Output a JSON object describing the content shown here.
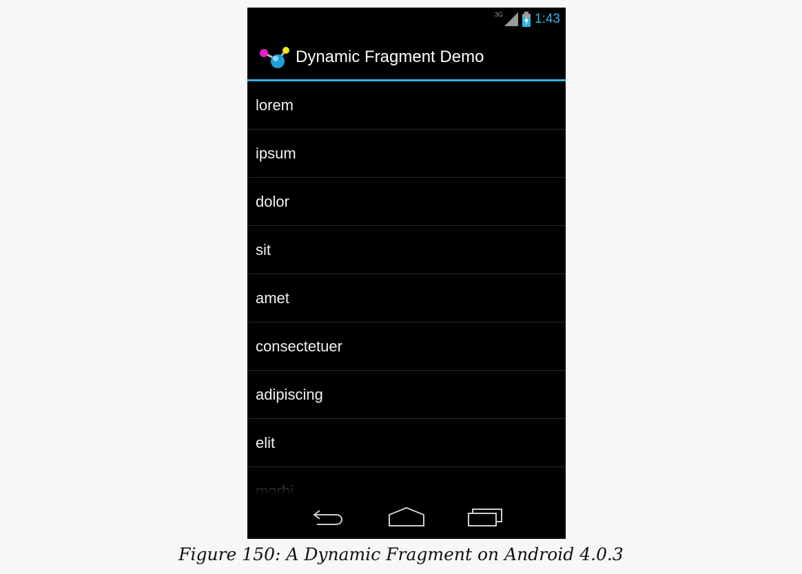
{
  "status_bar": {
    "network": "3G",
    "time": "1:43",
    "icons": [
      "signal-icon",
      "battery-charging-icon"
    ]
  },
  "action_bar": {
    "title": "Dynamic Fragment Demo",
    "icon": "app-icon"
  },
  "list": {
    "items": [
      "lorem",
      "ipsum",
      "dolor",
      "sit",
      "amet",
      "consectetuer",
      "adipiscing",
      "elit",
      "morbi"
    ]
  },
  "nav_bar": {
    "icons": [
      "back-icon",
      "home-icon",
      "recent-apps-icon"
    ]
  },
  "caption": "Figure 150: A Dynamic Fragment on Android 4.0.3",
  "colors": {
    "accent": "#33b5e5",
    "background": "#000000",
    "page": "#f7f7f7"
  }
}
